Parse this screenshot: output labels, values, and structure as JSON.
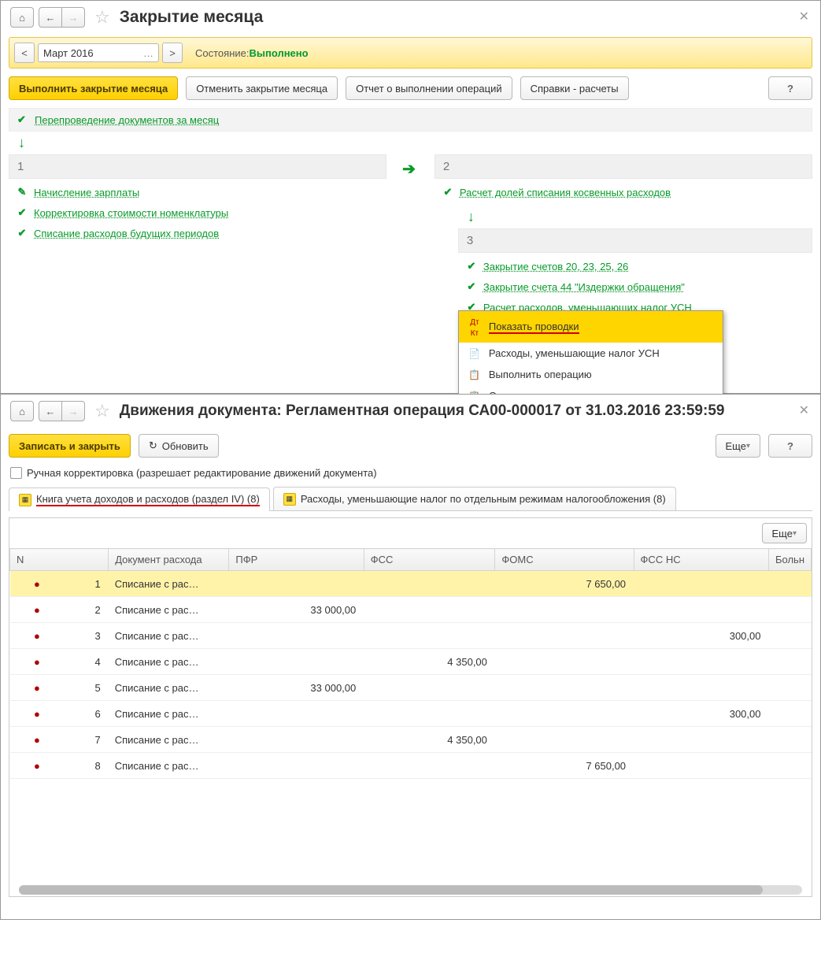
{
  "win1": {
    "title": "Закрытие месяца",
    "period": "Март 2016",
    "state_label": "Состояние:",
    "state_value": "Выполнено",
    "buttons": {
      "run": "Выполнить закрытие месяца",
      "cancel": "Отменить закрытие месяца",
      "report": "Отчет о выполнении операций",
      "ref": "Справки - расчеты",
      "help": "?"
    },
    "section0": "Перепроведение документов за месяц",
    "sec1_head": "1",
    "sec2_head": "2",
    "sec3_head": "3",
    "col1_ops": [
      "Начисление зарплаты",
      "Корректировка стоимости номенклатуры",
      "Списание расходов будущих периодов"
    ],
    "col2_op": "Расчет долей списания косвенных расходов",
    "col3_ops": [
      "Закрытие счетов 20, 23, 25, 26",
      "Закрытие счета 44 \"Издержки обращения\"",
      "Расчет расходов, уменьшающих налог УСН"
    ],
    "menu": [
      "Показать проводки",
      "Расходы, уменьшающие налог УСН",
      "Выполнить операцию",
      "Отменить операцию"
    ]
  },
  "win2": {
    "title": "Движения документа: Регламентная операция СА00-000017 от 31.03.2016 23:59:59",
    "buttons": {
      "save": "Записать и закрыть",
      "refresh": "Обновить",
      "more": "Еще",
      "help": "?"
    },
    "checkbox_label": "Ручная корректировка (разрешает редактирование движений документа)",
    "tabs": [
      "Книга учета доходов и расходов (раздел IV) (8)",
      "Расходы, уменьшающие налог по отдельным режимам налогообложения (8)"
    ],
    "columns": [
      "N",
      "Документ расхода",
      "ПФР",
      "ФСС",
      "ФОМС",
      "ФСС НС",
      "Больн"
    ],
    "doc_cell": "Списание с рас…",
    "rows": [
      {
        "n": 1,
        "pfr": "",
        "fss": "",
        "foms": "7 650,00",
        "fssns": ""
      },
      {
        "n": 2,
        "pfr": "33 000,00",
        "fss": "",
        "foms": "",
        "fssns": ""
      },
      {
        "n": 3,
        "pfr": "",
        "fss": "",
        "foms": "",
        "fssns": "300,00"
      },
      {
        "n": 4,
        "pfr": "",
        "fss": "4 350,00",
        "foms": "",
        "fssns": ""
      },
      {
        "n": 5,
        "pfr": "33 000,00",
        "fss": "",
        "foms": "",
        "fssns": ""
      },
      {
        "n": 6,
        "pfr": "",
        "fss": "",
        "foms": "",
        "fssns": "300,00"
      },
      {
        "n": 7,
        "pfr": "",
        "fss": "4 350,00",
        "foms": "",
        "fssns": ""
      },
      {
        "n": 8,
        "pfr": "",
        "fss": "",
        "foms": "7 650,00",
        "fssns": ""
      }
    ]
  }
}
